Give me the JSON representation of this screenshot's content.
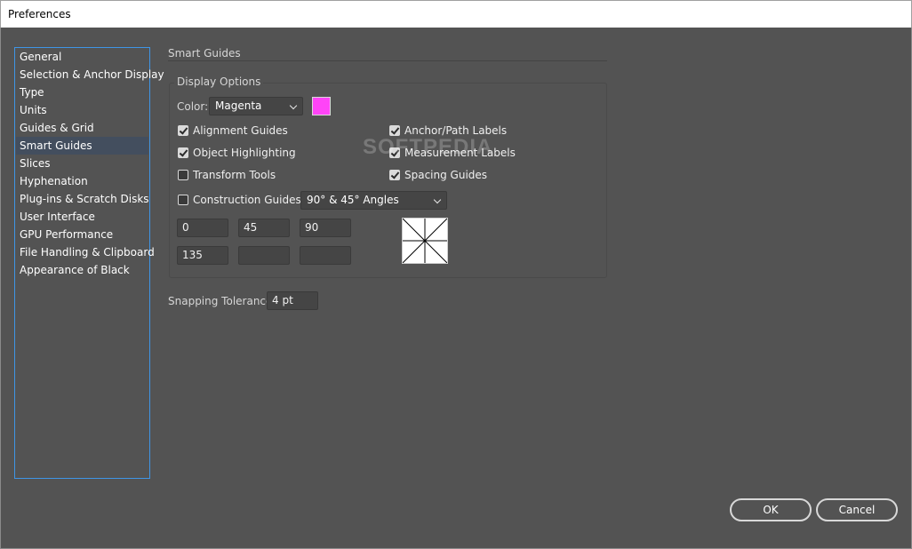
{
  "window": {
    "title": "Preferences"
  },
  "sidebar": {
    "items": [
      {
        "label": "General"
      },
      {
        "label": "Selection & Anchor Display"
      },
      {
        "label": "Type"
      },
      {
        "label": "Units"
      },
      {
        "label": "Guides & Grid"
      },
      {
        "label": "Smart Guides",
        "selected": true
      },
      {
        "label": "Slices"
      },
      {
        "label": "Hyphenation"
      },
      {
        "label": "Plug-ins & Scratch Disks"
      },
      {
        "label": "User Interface"
      },
      {
        "label": "GPU Performance"
      },
      {
        "label": "File Handling & Clipboard"
      },
      {
        "label": "Appearance of Black"
      }
    ]
  },
  "main": {
    "section_title": "Smart Guides",
    "display_options": {
      "title": "Display Options",
      "color_label": "Color:",
      "color_value": "Magenta",
      "swatch_color": "#ff44f7",
      "checkboxes": {
        "alignment_guides": {
          "label": "Alignment Guides",
          "checked": true
        },
        "object_highlighting": {
          "label": "Object Highlighting",
          "checked": true
        },
        "transform_tools": {
          "label": "Transform Tools",
          "checked": false
        },
        "anchor_path_labels": {
          "label": "Anchor/Path Labels",
          "checked": true
        },
        "measurement_labels": {
          "label": "Measurement Labels",
          "checked": true
        },
        "spacing_guides": {
          "label": "Spacing Guides",
          "checked": true
        },
        "construction_guides": {
          "label": "Construction Guides:",
          "checked": false
        }
      },
      "angles_dropdown": "90° & 45° Angles",
      "angles": [
        "0",
        "45",
        "90",
        "135",
        "",
        ""
      ]
    },
    "snapping_tolerance_label": "Snapping Tolerance:",
    "snapping_tolerance_value": "4 pt"
  },
  "watermark": "SOFTPEDIA",
  "buttons": {
    "ok": "OK",
    "cancel": "Cancel"
  },
  "colors": {
    "background": "#535353",
    "selection": "#434e5e",
    "focus_border": "#3f95e6"
  }
}
